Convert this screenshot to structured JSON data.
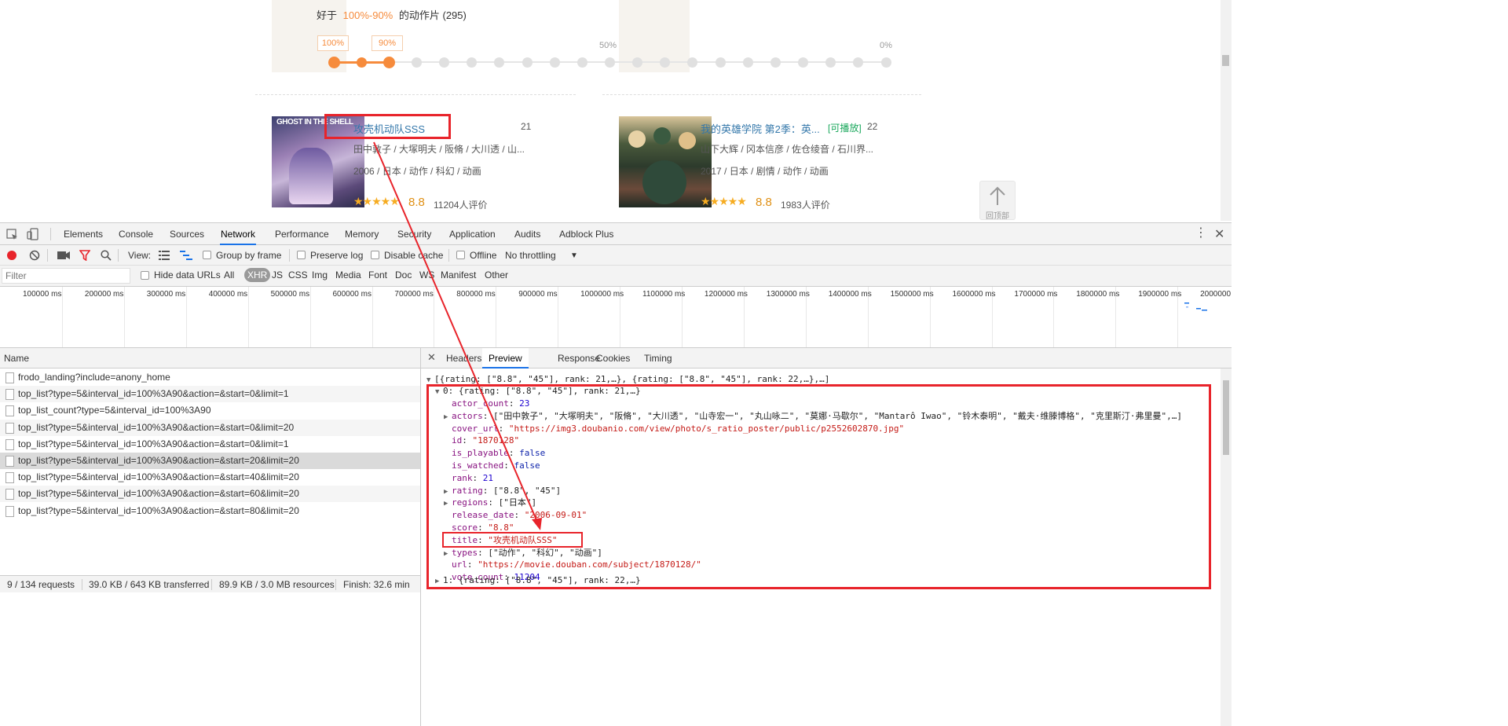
{
  "webpage": {
    "filter_heading": {
      "prefix": "好于",
      "range": "100%-90%",
      "suffix": "的动作片 (295)"
    },
    "slider": {
      "label_100": "100%",
      "label_90": "90%",
      "mark_50": "50%",
      "mark_0": "0%",
      "range_low_fraction": 0.9,
      "range_high_fraction": 1.0
    },
    "movies": [
      {
        "title": "攻壳机动队SSS",
        "rank": "21",
        "actors": "田中敦子 / 大塚明夫 / 阪脩 / 大川透 / 山...",
        "meta": "2006 / 日本 / 动作 / 科幻 / 动画",
        "stars": "★★★★★",
        "score": "8.8",
        "votes": "11204人评价",
        "playable": ""
      },
      {
        "title": "我的英雄学院 第2季：英...",
        "rank": "22",
        "actors": "山下大辉 / 冈本信彦 / 佐仓绫音 / 石川界...",
        "meta": "2017 / 日本 / 剧情 / 动作 / 动画",
        "stars": "★★★★★",
        "score": "8.8",
        "votes": "1983人评价",
        "playable": "[可播放]"
      }
    ],
    "back_to_top": "回顶部"
  },
  "devtools": {
    "tabs": [
      "Elements",
      "Console",
      "Sources",
      "Network",
      "Performance",
      "Memory",
      "Security",
      "Application",
      "Audits",
      "Adblock Plus"
    ],
    "active_tab": "Network",
    "toolbar": {
      "view_label": "View:",
      "group_by_frame": "Group by frame",
      "preserve_log": "Preserve log",
      "disable_cache": "Disable cache",
      "offline": "Offline",
      "throttling": "No throttling"
    },
    "filter": {
      "placeholder": "Filter",
      "hide_data_urls": "Hide data URLs",
      "types": [
        "All",
        "XHR",
        "JS",
        "CSS",
        "Img",
        "Media",
        "Font",
        "Doc",
        "WS",
        "Manifest",
        "Other"
      ],
      "active_type": "XHR"
    },
    "timeline_ticks": [
      "100000 ms",
      "200000 ms",
      "300000 ms",
      "400000 ms",
      "500000 ms",
      "600000 ms",
      "700000 ms",
      "800000 ms",
      "900000 ms",
      "1000000 ms",
      "1100000 ms",
      "1200000 ms",
      "1300000 ms",
      "1400000 ms",
      "1500000 ms",
      "1600000 ms",
      "1700000 ms",
      "1800000 ms",
      "1900000 ms",
      "2000000 m"
    ],
    "requests_header": "Name",
    "requests": [
      "frodo_landing?include=anony_home",
      "top_list?type=5&interval_id=100%3A90&action=&start=0&limit=1",
      "top_list_count?type=5&interval_id=100%3A90",
      "top_list?type=5&interval_id=100%3A90&action=&start=0&limit=20",
      "top_list?type=5&interval_id=100%3A90&action=&start=0&limit=1",
      "top_list?type=5&interval_id=100%3A90&action=&start=20&limit=20",
      "top_list?type=5&interval_id=100%3A90&action=&start=40&limit=20",
      "top_list?type=5&interval_id=100%3A90&action=&start=60&limit=20",
      "top_list?type=5&interval_id=100%3A90&action=&start=80&limit=20"
    ],
    "selected_request_index": 5,
    "status": {
      "requests": "9 / 134 requests",
      "transferred": "39.0 KB / 643 KB transferred",
      "resources": "89.9 KB / 3.0 MB resources",
      "finish": "Finish: 32.6 min"
    },
    "preview_tabs": [
      "Headers",
      "Preview",
      "Response",
      "Cookies",
      "Timing"
    ],
    "active_preview_tab": "Preview",
    "preview": {
      "root_summary": "[{rating: [\"8.8\", \"45\"], rank: 21,…}, {rating: [\"8.8\", \"45\"], rank: 22,…},…]",
      "item0_summary": "0: {rating: [\"8.8\", \"45\"], rank: 21,…}",
      "fields": [
        {
          "key": "actor_count",
          "value": "23",
          "kind": "num",
          "expandable": false
        },
        {
          "key": "actors",
          "value": "[\"田中敦子\", \"大塚明夫\", \"阪脩\", \"大川透\", \"山寺宏一\", \"丸山咏二\", \"莫娜·马歇尔\", \"Mantarô Iwao\", \"铃木泰明\", \"戴夫·维滕博格\", \"克里斯汀·弗里曼\",…]",
          "kind": "arr",
          "expandable": true
        },
        {
          "key": "cover_url",
          "value": "\"https://img3.doubanio.com/view/photo/s_ratio_poster/public/p2552602870.jpg\"",
          "kind": "str",
          "expandable": false
        },
        {
          "key": "id",
          "value": "\"1870128\"",
          "kind": "str",
          "expandable": false
        },
        {
          "key": "is_playable",
          "value": "false",
          "kind": "bool",
          "expandable": false
        },
        {
          "key": "is_watched",
          "value": "false",
          "kind": "bool",
          "expandable": false
        },
        {
          "key": "rank",
          "value": "21",
          "kind": "num",
          "expandable": false
        },
        {
          "key": "rating",
          "value": "[\"8.8\", \"45\"]",
          "kind": "arr",
          "expandable": true
        },
        {
          "key": "regions",
          "value": "[\"日本\"]",
          "kind": "arr",
          "expandable": true
        },
        {
          "key": "release_date",
          "value": "\"2006-09-01\"",
          "kind": "str",
          "expandable": false
        },
        {
          "key": "score",
          "value": "\"8.8\"",
          "kind": "str",
          "expandable": false
        },
        {
          "key": "title",
          "value": "\"攻壳机动队SSS\"",
          "kind": "str",
          "expandable": false
        },
        {
          "key": "types",
          "value": "[\"动作\", \"科幻\", \"动画\"]",
          "kind": "arr",
          "expandable": true
        },
        {
          "key": "url",
          "value": "\"https://movie.douban.com/subject/1870128/\"",
          "kind": "str",
          "expandable": false
        },
        {
          "key": "vote_count",
          "value": "11204",
          "kind": "num",
          "expandable": false
        }
      ],
      "next_item_summary": "1: {rating: [\"8.8\", \"45\"], rank: 22,…}"
    }
  },
  "colors": {
    "annotation": "#e8242b",
    "accent_orange": "#f68b3c",
    "link_blue": "#3377aa",
    "devtools_active": "#1a73e8",
    "record_red": "#e8242b"
  }
}
